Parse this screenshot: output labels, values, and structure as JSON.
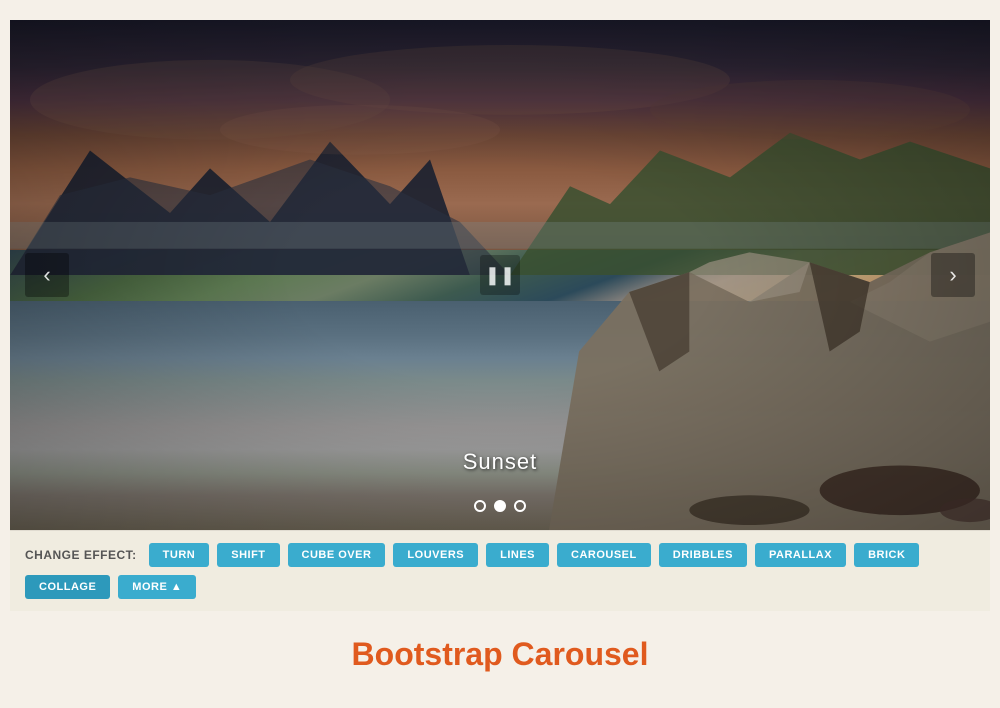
{
  "carousel": {
    "caption": "Sunset",
    "indicators": [
      {
        "id": 0,
        "active": false
      },
      {
        "id": 1,
        "active": true
      },
      {
        "id": 2,
        "active": false
      }
    ],
    "prev_label": "‹",
    "next_label": "›",
    "pause_label": "❚❚"
  },
  "effects_bar": {
    "label": "CHANGE EFFECT:",
    "buttons": [
      {
        "id": "turn",
        "label": "TURN"
      },
      {
        "id": "shift",
        "label": "SHIFT"
      },
      {
        "id": "cube-over",
        "label": "CUBE OVER"
      },
      {
        "id": "louvers",
        "label": "LOUVERS"
      },
      {
        "id": "lines",
        "label": "LINES"
      },
      {
        "id": "carousel",
        "label": "CAROUSEL"
      },
      {
        "id": "dribbles",
        "label": "DRIBBLES"
      },
      {
        "id": "parallax",
        "label": "PARALLAX"
      },
      {
        "id": "brick",
        "label": "BRICK"
      },
      {
        "id": "collage",
        "label": "COLLAGE"
      },
      {
        "id": "more",
        "label": "MORE ▲"
      }
    ]
  },
  "title": {
    "text": "Bootstrap Carousel"
  },
  "colors": {
    "accent_blue": "#3aacce",
    "accent_red": "#e05a1e"
  }
}
